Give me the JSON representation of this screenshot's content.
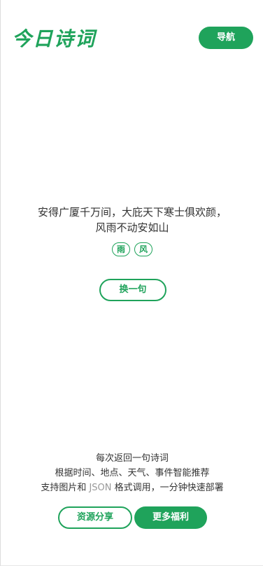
{
  "header": {
    "logo_text": "今日诗词",
    "nav_label": "导航"
  },
  "poem": {
    "lines": [
      "安得广厦千万间，大庇天下寒士俱欢颜，",
      "风雨不动安如山"
    ],
    "tags": [
      "雨",
      "风"
    ]
  },
  "actions": {
    "refresh_label": "换一句"
  },
  "description": {
    "line1": "每次返回一句诗词",
    "line2": "根据时间、地点、天气、事件智能推荐",
    "line3_prefix": "支持图片和 ",
    "line3_json": "JSON",
    "line3_suffix": " 格式调用，一分钟快速部署"
  },
  "footer": {
    "resources_label": "资源分享",
    "benefits_label": "更多福利"
  },
  "colors": {
    "accent": "#1fa35b",
    "text": "#333333",
    "muted": "#999999"
  }
}
